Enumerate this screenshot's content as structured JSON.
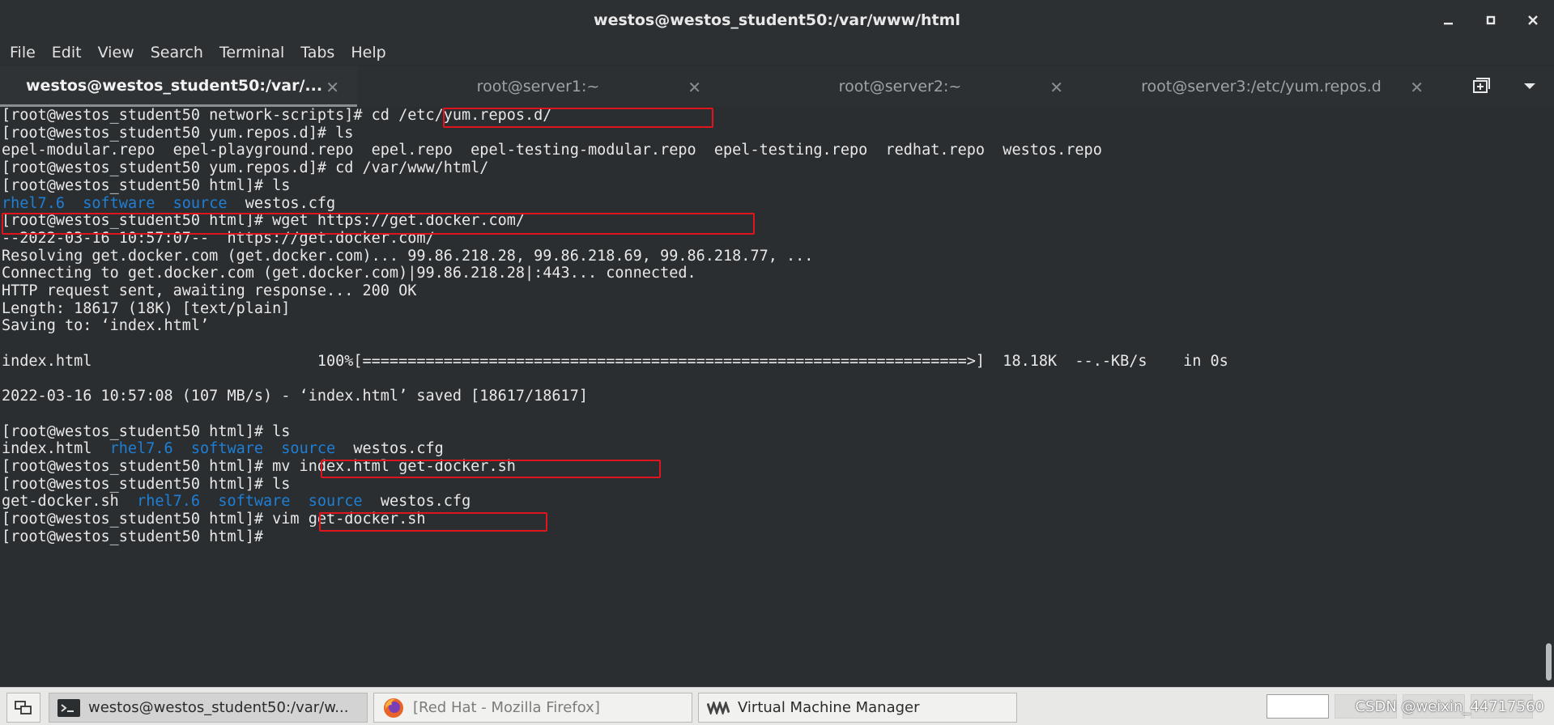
{
  "window": {
    "title": "westos@westos_student50:/var/www/html"
  },
  "menu": [
    "File",
    "Edit",
    "View",
    "Search",
    "Terminal",
    "Tabs",
    "Help"
  ],
  "tabs": [
    {
      "label": "westos@westos_student50:/var/..."
    },
    {
      "label": "root@server1:~"
    },
    {
      "label": "root@server2:~"
    },
    {
      "label": "root@server3:/etc/yum.repos.d"
    }
  ],
  "icons": {
    "minimize": "minimize-icon",
    "maximize": "maximize-icon",
    "close": "close-icon",
    "tab_close": "close-icon",
    "new_tab": "new-tab-icon",
    "tab_menu": "chevron-down-icon",
    "show_desktop": "show-desktop-icon",
    "terminal": "terminal-icon",
    "firefox": "firefox-icon",
    "virt_manager": "virt-manager-icon"
  },
  "terminal": {
    "lines": [
      [
        "[root@westos_student50 network-scripts]# cd /etc/yum.repos.d/"
      ],
      [
        "[root@westos_student50 yum.repos.d]# ls"
      ],
      [
        "epel-modular.repo  epel-playground.repo  epel.repo  epel-testing-modular.repo  epel-testing.repo  redhat.repo  westos.repo"
      ],
      [
        "[root@westos_student50 yum.repos.d]# cd /var/www/html/"
      ],
      [
        "[root@westos_student50 html]# ls"
      ],
      [
        "rhel7.6",
        "  ",
        "software",
        "  ",
        "source",
        "  westos.cfg"
      ],
      [
        "[root@westos_student50 html]# wget https://get.docker.com/"
      ],
      [
        "--2022-03-16 10:57:07--  https://get.docker.com/"
      ],
      [
        "Resolving get.docker.com (get.docker.com)... 99.86.218.28, 99.86.218.69, 99.86.218.77, ..."
      ],
      [
        "Connecting to get.docker.com (get.docker.com)|99.86.218.28|:443... connected."
      ],
      [
        "HTTP request sent, awaiting response... 200 OK"
      ],
      [
        "Length: 18617 (18K) [text/plain]"
      ],
      [
        "Saving to: ‘index.html’"
      ],
      [
        ""
      ],
      [
        "index.html                         100%[===================================================================>]  18.18K  --.-KB/s    in 0s"
      ],
      [
        ""
      ],
      [
        "2022-03-16 10:57:08 (107 MB/s) - ‘index.html’ saved [18617/18617]"
      ],
      [
        ""
      ],
      [
        "[root@westos_student50 html]# ls"
      ],
      [
        "index.html  ",
        "rhel7.6",
        "  ",
        "software",
        "  ",
        "source",
        "  westos.cfg"
      ],
      [
        "[root@westos_student50 html]# mv index.html get-docker.sh"
      ],
      [
        "[root@westos_student50 html]# ls"
      ],
      [
        "get-docker.sh  ",
        "rhel7.6",
        "  ",
        "software",
        "  ",
        "source",
        "  westos.cfg"
      ],
      [
        "[root@westos_student50 html]# vim get-docker.sh"
      ],
      [
        "[root@westos_student50 html]# "
      ]
    ],
    "highlight_color": "#e0141c",
    "dir_color": "#1e7fd6"
  },
  "taskbar": {
    "items": [
      {
        "label": "westos@westos_student50:/var/w..."
      },
      {
        "label": "[Red Hat - Mozilla Firefox]"
      },
      {
        "label": "Virtual Machine Manager"
      }
    ],
    "watermark": "CSDN @weixin_44717560"
  }
}
